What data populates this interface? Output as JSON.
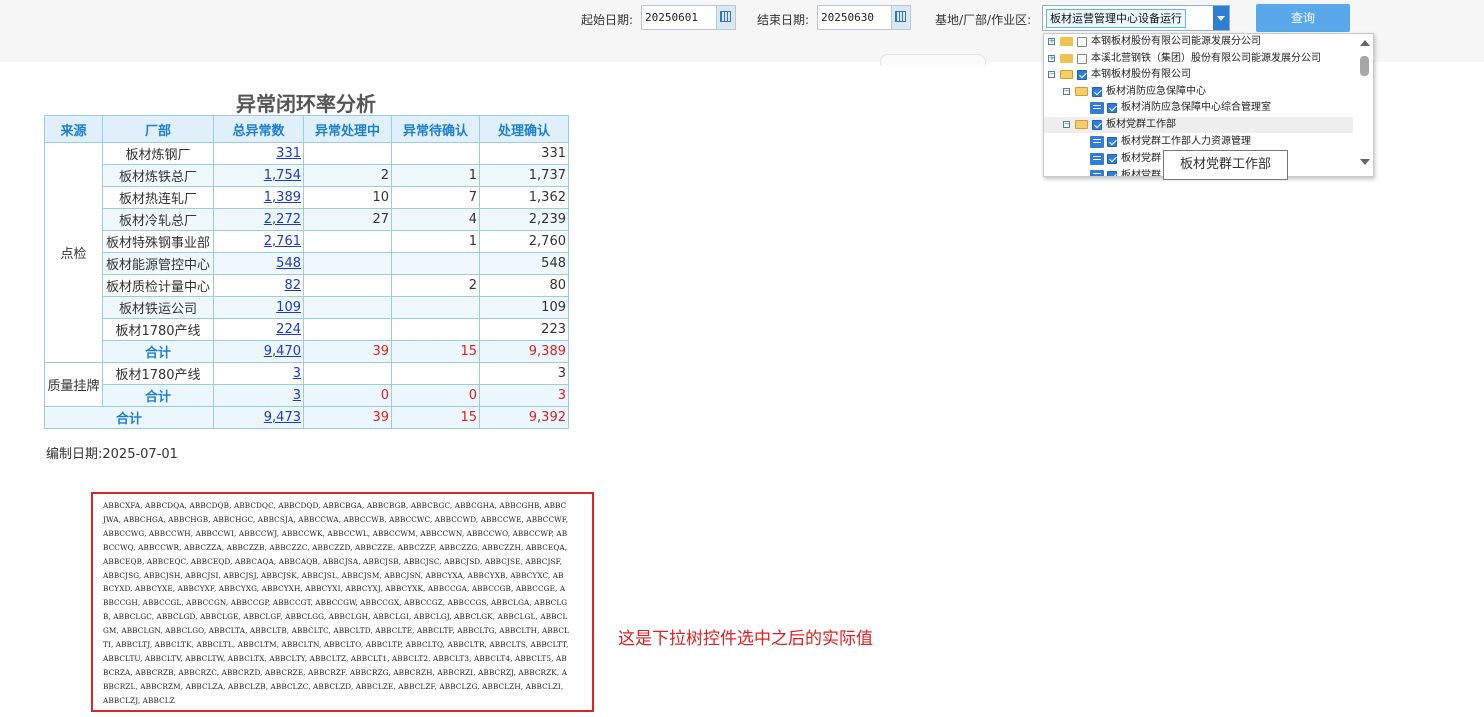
{
  "toolbar": {
    "start_label": "起始日期:",
    "start_value": "20250601",
    "end_label": "结束日期:",
    "end_value": "20250630",
    "org_label": "基地/厂部/作业区:",
    "org_selected": "板材运营管理中心设备运行",
    "query_label": "查询"
  },
  "tree": {
    "items": [
      {
        "label": "本钢板材股份有限公司能源发展分公司",
        "checked": false
      },
      {
        "label": "本溪北营钢铁（集团）股份有限公司能源发展分公司",
        "checked": false
      },
      {
        "label": "本钢板材股份有限公司",
        "checked": true
      },
      {
        "label": "板材消防应急保障中心",
        "checked": true
      },
      {
        "label": "板材消防应急保障中心综合管理室",
        "checked": true
      },
      {
        "label": "板材党群工作部",
        "checked": true
      },
      {
        "label": "板材党群工作部人力资源管理",
        "checked": true
      },
      {
        "label": "板材党群",
        "checked": true
      },
      {
        "label": "板材党群",
        "checked": true
      }
    ],
    "tooltip": "板材党群工作部"
  },
  "report": {
    "title": "异常闭环率分析",
    "headers": [
      "来源",
      "厂部",
      "总异常数",
      "异常处理中",
      "异常待确认",
      "处理确认"
    ],
    "group1": {
      "source": "点检",
      "rows": [
        {
          "factory": "板材炼钢厂",
          "total": "331",
          "processing": "",
          "pending": "",
          "confirmed": "331"
        },
        {
          "factory": "板材炼铁总厂",
          "total": "1,754",
          "processing": "2",
          "pending": "1",
          "confirmed": "1,737"
        },
        {
          "factory": "板材热连轧厂",
          "total": "1,389",
          "processing": "10",
          "pending": "7",
          "confirmed": "1,362"
        },
        {
          "factory": "板材冷轧总厂",
          "total": "2,272",
          "processing": "27",
          "pending": "4",
          "confirmed": "2,239"
        },
        {
          "factory": "板材特殊钢事业部",
          "total": "2,761",
          "processing": "",
          "pending": "1",
          "confirmed": "2,760"
        },
        {
          "factory": "板材能源管控中心",
          "total": "548",
          "processing": "",
          "pending": "",
          "confirmed": "548"
        },
        {
          "factory": "板材质检计量中心",
          "total": "82",
          "processing": "",
          "pending": "2",
          "confirmed": "80"
        },
        {
          "factory": "板材铁运公司",
          "total": "109",
          "processing": "",
          "pending": "",
          "confirmed": "109"
        },
        {
          "factory": "板材1780产线",
          "total": "224",
          "processing": "",
          "pending": "",
          "confirmed": "223"
        }
      ],
      "subtotal": {
        "label": "合计",
        "total": "9,470",
        "processing": "39",
        "pending": "15",
        "confirmed": "9,389"
      }
    },
    "group2": {
      "source": "质量挂牌",
      "rows": [
        {
          "factory": "板材1780产线",
          "total": "3",
          "processing": "",
          "pending": "",
          "confirmed": "3"
        }
      ],
      "subtotal": {
        "label": "合计",
        "total": "3",
        "processing": "0",
        "pending": "0",
        "confirmed": "3"
      }
    },
    "grand_total": {
      "label": "合计",
      "total": "9,473",
      "processing": "39",
      "pending": "15",
      "confirmed": "9,392"
    },
    "edit_date": "编制日期:2025-07-01"
  },
  "selected_values": "ABBCXFA, ABBCDQA, ABBCDQB, ABBCDQC, ABBCDQD, ABBCBGA, ABBCBGB, ABBCBGC, ABBCGHA, ABBCGHB, ABBCJWA, ABBCHGA, ABBCHGB, ABBCHGC, ABBCSJA, ABBCCWA, ABBCCWB, ABBCCWC, ABBCCWD, ABBCCWE, ABBCCWF, ABBCCWG, ABBCCWH, ABBCCWI, ABBCCWJ, ABBCCWK, ABBCCWL, ABBCCWM, ABBCCWN, ABBCCWO, ABBCCWP, ABBCCWQ, ABBCCWR, ABBCZZA, ABBCZZB, ABBCZZC, ABBCZZD, ABBCZZE, ABBCZZF, ABBCZZG, ABBCZZH, ABBCEQA, ABBCEQB, ABBCEQC, ABBCEQD, ABBCAQA, ABBCAQB, ABBCJSA, ABBCJSB, ABBCJSC, ABBCJSD, ABBCJSE, ABBCJSF, ABBCJSG, ABBCJSH, ABBCJSI, ABBCJSJ, ABBCJSK, ABBCJSL, ABBCJSM, ABBCJSN, ABBCYXA, ABBCYXB, ABBCYXC, ABBCYXD, ABBCYXE, ABBCYXF, ABBCYXG, ABBCYXH, ABBCYXI, ABBCYXJ, ABBCYXK, ABBCCGA, ABBCCGB, ABBCCGE, ABBCCGH, ABBCCGL, ABBCCGN, ABBCCGP, ABBCCGT, ABBCCGW, ABBCCGX, ABBCCGZ, ABBCCGS, ABBCLGA, ABBCLGB, ABBCLGC, ABBCLGD, ABBCLGE, ABBCLGF, ABBCLGG, ABBCLGH, ABBCLGI, ABBCLGJ, ABBCLGK, ABBCLGL, ABBCLGM, ABBCLGN, ABBCLGO, ABBCLTA, ABBCLTB, ABBCLTC, ABBCLTD, ABBCLTE, ABBCLTF, ABBCLTG, ABBCLTH, ABBCLTI, ABBCLTJ, ABBCLTK, ABBCLTL, ABBCLTM, ABBCLTN, ABBCLTO, ABBCLTP, ABBCLTQ, ABBCLTR, ABBCLTS, ABBCLTT, ABBCLTU, ABBCLTV, ABBCLTW, ABBCLTX, ABBCLTY, ABBCLTZ, ABBCLT1, ABBCLT2, ABBCLT3, ABBCLT4, ABBCLT5, ABBCRZA, ABBCRZB, ABBCRZC, ABBCRZD, ABBCRZE, ABBCRZF, ABBCRZG, ABBCRZH, ABBCRZI, ABBCRZJ, ABBCRZK, ABBCRZL, ABBCRZM, ABBCLZA, ABBCLZB, ABBCLZC, ABBCLZD, ABBCLZE, ABBCLZF, ABBCLZG, ABBCLZH, ABBCLZI, ABBCLZJ, ABBCLZ",
  "note": "这是下拉树控件选中之后的实际值",
  "colors": {
    "accent": "#2d7fd3",
    "header_bg": "#dff0fb",
    "red": "#e02020",
    "link": "#1a3ad0"
  }
}
